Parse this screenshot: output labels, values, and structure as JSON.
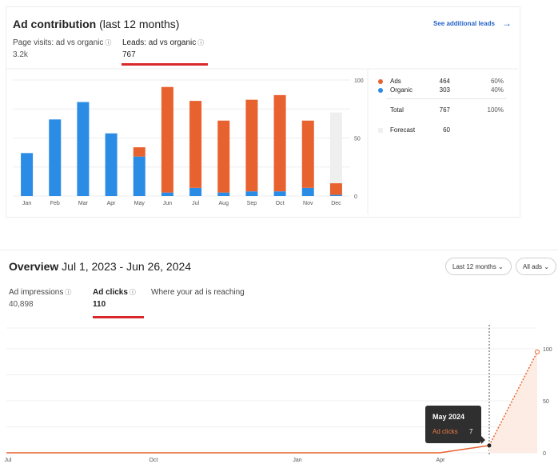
{
  "contribution": {
    "title_bold": "Ad contribution",
    "title_rest": "(last 12 months)",
    "link_label": "See additional leads",
    "arrow_icon": "→",
    "tabs": [
      {
        "label": "Page visits: ad vs organic",
        "value": "3.2k",
        "active": false
      },
      {
        "label": "Leads: ad vs organic",
        "value": "767",
        "active": true
      }
    ],
    "info_icon": "ⓘ"
  },
  "legend": {
    "rows": [
      {
        "name": "Ads",
        "count": "464",
        "pct": "60%",
        "color": "#e8622f"
      },
      {
        "name": "Organic",
        "count": "303",
        "pct": "40%",
        "color": "#2b8ce6"
      }
    ],
    "total": {
      "name": "Total",
      "count": "767",
      "pct": "100%"
    },
    "forecast": {
      "name": "Forecast",
      "count": "60",
      "color": "#efefef"
    }
  },
  "overview": {
    "title_bold": "Overview",
    "title_rest": "Jul 1, 2023 - Jun 26, 2024",
    "range_label": "Last 12 months",
    "ads_label": "All ads",
    "chevron": "⌄",
    "tabs": [
      {
        "label": "Ad impressions",
        "value": "40,898",
        "active": false
      },
      {
        "label": "Ad clicks",
        "value": "110",
        "active": true
      },
      {
        "label": "Where your ad is reaching",
        "value": "",
        "active": false
      }
    ],
    "tooltip": {
      "title": "May 2024",
      "series": "Ad clicks",
      "value": "7"
    }
  },
  "chart_data": [
    {
      "type": "bar",
      "stacked": true,
      "categories": [
        "Jan",
        "Feb",
        "Mar",
        "Apr",
        "May",
        "Jun",
        "Jul",
        "Aug",
        "Sep",
        "Oct",
        "Nov",
        "Dec"
      ],
      "series": [
        {
          "name": "Organic",
          "color": "#2b8ce6",
          "values": [
            37,
            66,
            81,
            54,
            34,
            3,
            7,
            3,
            4,
            4,
            7,
            1
          ]
        },
        {
          "name": "Ads",
          "color": "#e8622f",
          "values": [
            0,
            0,
            0,
            0,
            8,
            91,
            75,
            62,
            79,
            83,
            58,
            10
          ]
        },
        {
          "name": "Forecast",
          "color": "#efefef",
          "values": [
            0,
            0,
            0,
            0,
            0,
            0,
            0,
            0,
            0,
            0,
            0,
            61
          ]
        }
      ],
      "ylim": [
        0,
        100
      ],
      "yticks": [
        0,
        50,
        100
      ],
      "grid": true,
      "legend_position": "right"
    },
    {
      "type": "line",
      "x_labels": [
        "Jul",
        "Oct",
        "Jan",
        "Apr"
      ],
      "series": [
        {
          "name": "Ad clicks",
          "color": "#e8622f",
          "points": [
            [
              0,
              0
            ],
            [
              9,
              0
            ],
            [
              10,
              7
            ],
            [
              11,
              97
            ]
          ],
          "dotted_from": 10
        }
      ],
      "ylim": [
        0,
        120
      ],
      "yticks": [
        0,
        50,
        100
      ],
      "highlight": {
        "label": "May 2024",
        "value": 7
      },
      "grid": true
    }
  ]
}
